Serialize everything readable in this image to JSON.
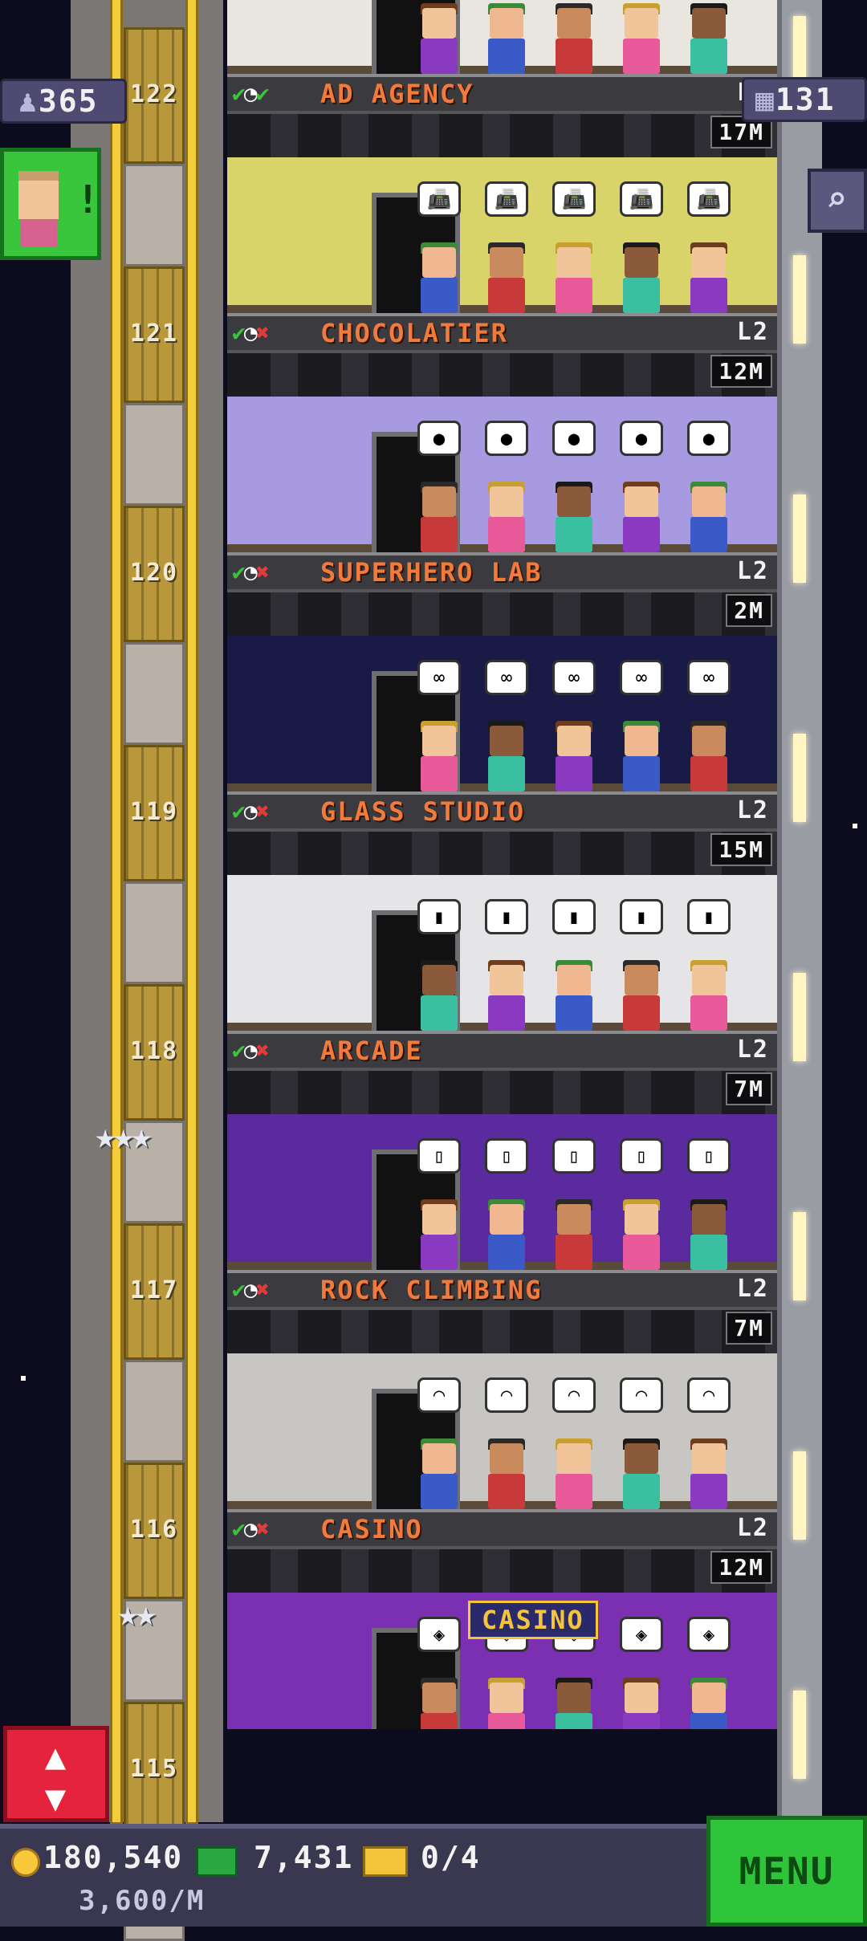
{
  "top": {
    "population": "365",
    "floors": "131"
  },
  "shaft": [
    {
      "number": "122"
    },
    {
      "number": "121"
    },
    {
      "number": "120"
    },
    {
      "number": "119"
    },
    {
      "number": "118"
    },
    {
      "number": "117"
    },
    {
      "number": "116"
    },
    {
      "number": "115"
    }
  ],
  "floors": [
    {
      "name": "AD AGENCY",
      "level": "L2",
      "time": "17M",
      "status": [
        "ok",
        "clock",
        "ok"
      ],
      "wall": "#e9e6df",
      "bubble": "🖼"
    },
    {
      "name": "CHOCOLATIER",
      "level": "L2",
      "time": "12M",
      "status": [
        "ok",
        "clock",
        "no"
      ],
      "wall": "#d8d46a",
      "bubble": "📠"
    },
    {
      "name": "SUPERHERO LAB",
      "level": "L2",
      "time": "2M",
      "status": [
        "ok",
        "clock",
        "no"
      ],
      "wall": "#a89ae0",
      "bubble": "●"
    },
    {
      "name": "GLASS STUDIO",
      "level": "L2",
      "time": "15M",
      "status": [
        "ok",
        "clock",
        "no"
      ],
      "wall": "#1a1a46",
      "bubble": "∞"
    },
    {
      "name": "ARCADE",
      "level": "L2",
      "time": "7M",
      "status": [
        "ok",
        "clock",
        "no"
      ],
      "wall": "#e5e5e8",
      "bubble": "▮"
    },
    {
      "name": "ROCK CLIMBING",
      "level": "L2",
      "time": "7M",
      "status": [
        "ok",
        "clock",
        "no"
      ],
      "wall": "#5a2a9e",
      "bubble": "▯"
    },
    {
      "name": "CASINO",
      "level": "L2",
      "time": "12M",
      "status": [
        "ok",
        "clock",
        "no"
      ],
      "wall": "#c8c6c2",
      "bubble": "◠"
    }
  ],
  "bottom_room": {
    "sign": "CASINO",
    "wall": "#7a30b0",
    "bubble": "◈"
  },
  "hud": {
    "coins": "180,540",
    "bux": "7,431",
    "tickets": "0/4",
    "rate": "3,600/M",
    "menu": "MENU"
  },
  "icons": {
    "check": "✔",
    "clock": "◔",
    "cross": "✖",
    "arrows": "▲▼",
    "search": "⌕"
  }
}
